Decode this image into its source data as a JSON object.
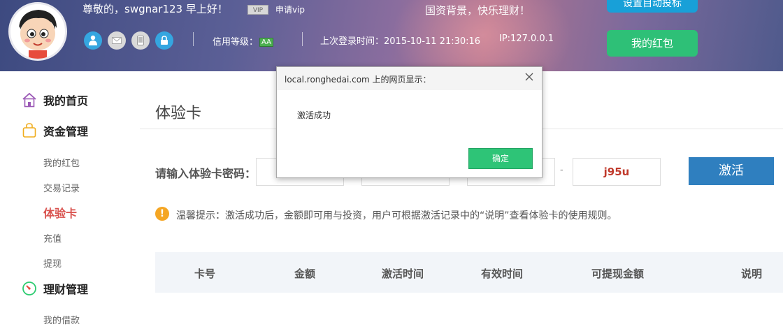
{
  "header": {
    "greeting": "尊敬的，swgnar123  早上好！",
    "vip_badge": "VIP",
    "apply_vip": "申请vip",
    "slogan": "国资背景，快乐理财！",
    "auto_bid_button": "设置自动投标",
    "redpack_button": "我的红包",
    "credit_label": "信用等级：",
    "credit_value": "AA",
    "last_login": "上次登录时间：2015-10-11 21:30:16",
    "ip": "IP:127.0.0.1",
    "colors": {
      "header_start": "#3d4a80",
      "header_mid": "#b0738f",
      "green_button": "#2ec077",
      "blue_button": "#18a0d8"
    }
  },
  "sidebar": {
    "groups": [
      {
        "label": "我的首页",
        "icon": "home-icon"
      },
      {
        "label": "资金管理",
        "icon": "bag-icon"
      },
      {
        "label": "理财管理",
        "icon": "gauge-icon"
      }
    ],
    "items": [
      {
        "label": "我的红包"
      },
      {
        "label": "交易记录"
      },
      {
        "label": "体验卡"
      },
      {
        "label": "充值"
      },
      {
        "label": "提现"
      },
      {
        "label": "我的借款"
      }
    ],
    "active_item": "体验卡"
  },
  "main": {
    "title": "体验卡",
    "password_label": "请输入体验卡密码：",
    "password_fields": [
      "",
      "",
      "",
      "j95u"
    ],
    "separator": "-",
    "activate_button": "激活",
    "tip": "温馨提示：激活成功后，金额即可用与投资，用户可根据激活记录中的“说明”查看体验卡的使用规则。",
    "table_columns": [
      "卡号",
      "金额",
      "激活时间",
      "有效时间",
      "可提现金额",
      "说明"
    ]
  },
  "dialog": {
    "title": "local.ronghedai.com 上的网页显示：",
    "message": "激活成功",
    "ok_button": "确定"
  }
}
